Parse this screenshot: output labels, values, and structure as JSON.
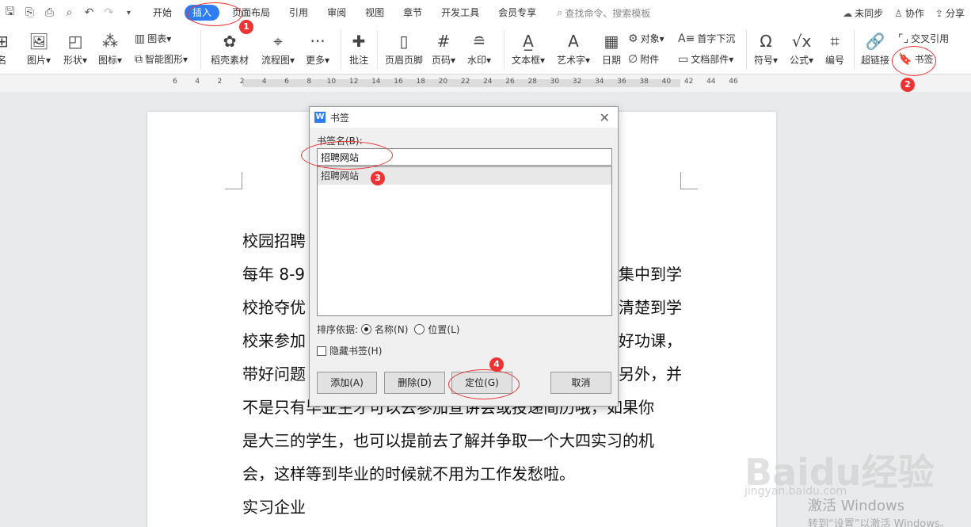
{
  "quick_access": [
    "save-icon",
    "export-icon",
    "print-icon",
    "preview-icon",
    "undo-icon",
    "redo-icon",
    "more-icon"
  ],
  "menu": {
    "tabs": [
      "开始",
      "插入",
      "页面布局",
      "引用",
      "审阅",
      "视图",
      "章节",
      "开发工具",
      "会员专享"
    ],
    "active_tab": "插入",
    "search_placeholder": "查找命令、搜索模板"
  },
  "topright": {
    "sync": "未同步",
    "collab": "协作",
    "share": "分享"
  },
  "ribbon": {
    "left_cut": "名",
    "picture": "图片",
    "shape": "形状",
    "icon": "图标",
    "chart": "图表",
    "smartart": "智能图形",
    "material": "稻壳素材",
    "flowchart": "流程图",
    "more": "更多",
    "comment": "批注",
    "header_footer": "页眉页脚",
    "page_number": "页码",
    "watermark": "水印",
    "textbox": "文本框",
    "wordart": "艺术字",
    "date": "日期",
    "object": "对象",
    "attachment": "附件",
    "dropcap": "首字下沉",
    "doc_parts": "文档部件",
    "symbol": "符号",
    "formula": "公式",
    "numbering": "编号",
    "hyperlink": "超链接",
    "crossref": "交叉引用",
    "bookmark": "书签"
  },
  "ruler": {
    "ticks": [
      "6",
      "4",
      "2",
      "2",
      "4",
      "6",
      "8",
      "10",
      "12",
      "14",
      "16",
      "18",
      "20",
      "22",
      "24",
      "26",
      "28",
      "30",
      "32",
      "34",
      "36",
      "38",
      "40",
      "42",
      "44",
      "46"
    ]
  },
  "document": {
    "lines": [
      [
        "校园招聘",
        ""
      ],
      [
        "每年 8-9 月",
        "集中到学"
      ],
      [
        "校抢夺优",
        "清楚到学"
      ],
      [
        "校来参加",
        "好功课，"
      ],
      [
        "带好问题",
        "另外，并"
      ],
      [
        "不是只有毕业生才可以去参加宣讲会或投递简历哦，如果你",
        ""
      ],
      [
        "是大三的学生，也可以提前去了解并争取一个大四实习的机",
        ""
      ],
      [
        "会，这样等到毕业的时候就不用为工作发愁啦。",
        ""
      ],
      [
        "实习企业",
        ""
      ]
    ]
  },
  "dialog": {
    "title": "书签",
    "name_label": "书签名(B):",
    "name_value": "招聘网站",
    "list_items": [
      "招聘网站"
    ],
    "sort_label": "排序依据:",
    "sort_name": "名称(N)",
    "sort_position": "位置(L)",
    "hidden_label": "隐藏书签(H)",
    "add": "添加(A)",
    "delete": "删除(D)",
    "goto": "定位(G)",
    "cancel": "取消"
  },
  "annotations": [
    "1",
    "2",
    "3",
    "4"
  ],
  "watermark": {
    "logo": "Baidu经验",
    "sub": "jingyan.baidu.com",
    "win1": "激活 Windows",
    "win2": "转到“设置”以激活 Windows。"
  },
  "colors": {
    "accent": "#2e7cf6",
    "annotation": "#e33333"
  }
}
